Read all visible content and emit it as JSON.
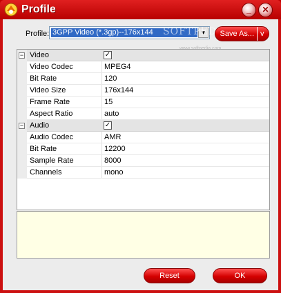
{
  "window": {
    "title": "Profile",
    "minimize_label": "_",
    "close_label": "✕"
  },
  "profile": {
    "label": "Profile:",
    "selected": "3GPP Video (*.3gp)--176x144",
    "dropdown_arrow": "▼"
  },
  "buttons": {
    "save_as": "Save As...",
    "save_as_arrow": "v",
    "reset": "Reset",
    "ok": "OK"
  },
  "watermark": {
    "text": "SOFTPEDIA",
    "url": "www.softpedia.com"
  },
  "properties": {
    "video": {
      "category": "Video",
      "expander": "−",
      "checked": "✓",
      "rows": [
        {
          "name": "Video Codec",
          "value": "MPEG4"
        },
        {
          "name": "Bit Rate",
          "value": "120"
        },
        {
          "name": "Video Size",
          "value": "176x144"
        },
        {
          "name": "Frame Rate",
          "value": "15"
        },
        {
          "name": "Aspect Ratio",
          "value": "auto"
        }
      ]
    },
    "audio": {
      "category": "Audio",
      "expander": "−",
      "checked": "✓",
      "rows": [
        {
          "name": "Audio Codec",
          "value": "AMR"
        },
        {
          "name": "Bit Rate",
          "value": "12200"
        },
        {
          "name": "Sample Rate",
          "value": "8000"
        },
        {
          "name": "Channels",
          "value": "mono"
        }
      ]
    }
  },
  "colors": {
    "titlebar": "#cc1010",
    "accent_button": "#d40000",
    "selection": "#316ac5",
    "description_bg": "#ffffe5"
  }
}
